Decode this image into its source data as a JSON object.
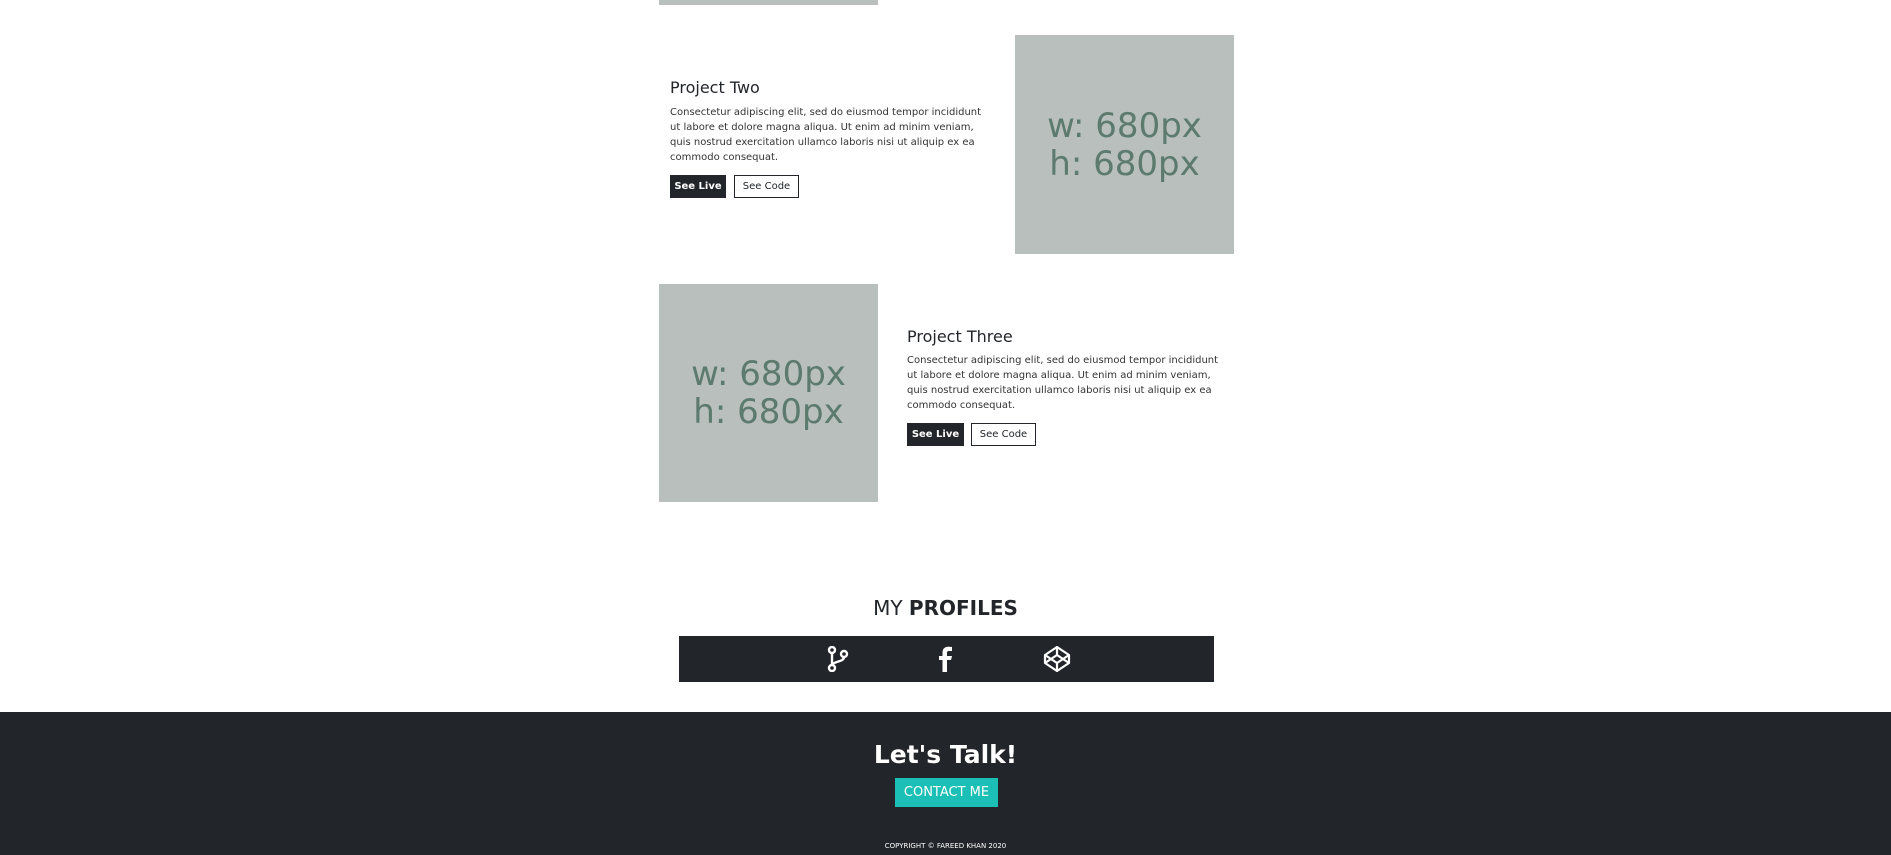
{
  "projects": [
    {
      "title": "Project Two",
      "description": "Consectetur adipiscing elit, sed do eiusmod tempor incididunt ut labore et dolore magna aliqua. Ut enim ad minim veniam, quis nostrud exercitation ullamco laboris nisi ut aliquip ex ea commodo consequat.",
      "live_label": "See Live",
      "code_label": "See Code",
      "image_line1": "w: 680px",
      "image_line2": "h: 680px"
    },
    {
      "title": "Project Three",
      "description": "Consectetur adipiscing elit, sed do eiusmod tempor incididunt ut labore et dolore magna aliqua. Ut enim ad minim veniam, quis nostrud exercitation ullamco laboris nisi ut aliquip ex ea commodo consequat.",
      "live_label": "See Live",
      "code_label": "See Code",
      "image_line1": "w: 680px",
      "image_line2": "h: 680px"
    }
  ],
  "profiles": {
    "title_prefix": "MY",
    "title_bold": "PROFILES",
    "icons": [
      "git-branch-icon",
      "facebook-icon",
      "codepen-icon"
    ]
  },
  "footer": {
    "heading": "Let's Talk!",
    "contact_label": "CONTACT ME",
    "copyright": "COPYRIGHT © FAREED KHAN 2020"
  },
  "colors": {
    "dark": "#222529",
    "accent": "#1bbfb5",
    "placeholder_bg": "#b8bfbd",
    "placeholder_text": "#5c7a6e"
  }
}
